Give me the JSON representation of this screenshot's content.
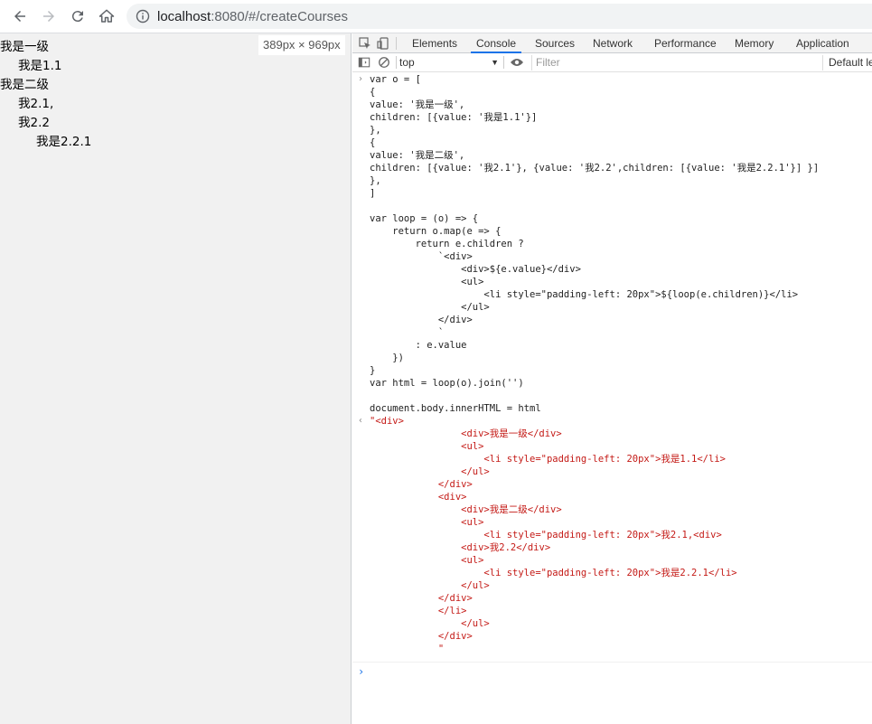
{
  "browser": {
    "url_host": "localhost",
    "url_path": ":8080/#/createCourses"
  },
  "page": {
    "size_badge": "389px × 969px",
    "items": [
      {
        "text": "我是一级"
      },
      {
        "text": "我是1.1"
      },
      {
        "text": "我是二级"
      },
      {
        "text": "我2.1,"
      },
      {
        "text": "我2.2"
      },
      {
        "text": "我是2.2.1"
      }
    ]
  },
  "devtools": {
    "tabs": [
      "Elements",
      "Console",
      "Sources",
      "Network",
      "Performance",
      "Memory",
      "Application"
    ],
    "active_tab": "Console",
    "context": "top",
    "filter_placeholder": "Filter",
    "levels": "Default levels",
    "input_lines": [
      "var o = [",
      "{",
      "value: '我是一级',",
      "children: [{value: '我是1.1'}]",
      "},",
      "{",
      "value: '我是二级',",
      "children: [{value: '我2.1'}, {value: '我2.2',children: [{value: '我是2.2.1'}] }]",
      "},",
      "]",
      "",
      "var loop = (o) => {",
      "    return o.map(e => {",
      "        return e.children ?",
      "            `<div>",
      "                <div>${e.value}</div>",
      "                <ul>",
      "                    <li style=\"padding-left: 20px\">${loop(e.children)}</li>",
      "                </ul>",
      "            </div>",
      "            `",
      "        : e.value",
      "    })",
      "}",
      "var html = loop(o).join('')",
      "",
      "document.body.innerHTML = html"
    ],
    "output_lines": [
      "\"<div>",
      "                <div>我是一级</div>",
      "                <ul>",
      "                    <li style=\"padding-left: 20px\">我是1.1</li>",
      "                </ul>",
      "            </div>",
      "            <div>",
      "                <div>我是二级</div>",
      "                <ul>",
      "                    <li style=\"padding-left: 20px\">我2.1,<div>",
      "                <div>我2.2</div>",
      "                <ul>",
      "                    <li style=\"padding-left: 20px\">我是2.2.1</li>",
      "                </ul>",
      "            </div>",
      "            </li>",
      "                </ul>",
      "            </div>",
      "            \""
    ]
  }
}
